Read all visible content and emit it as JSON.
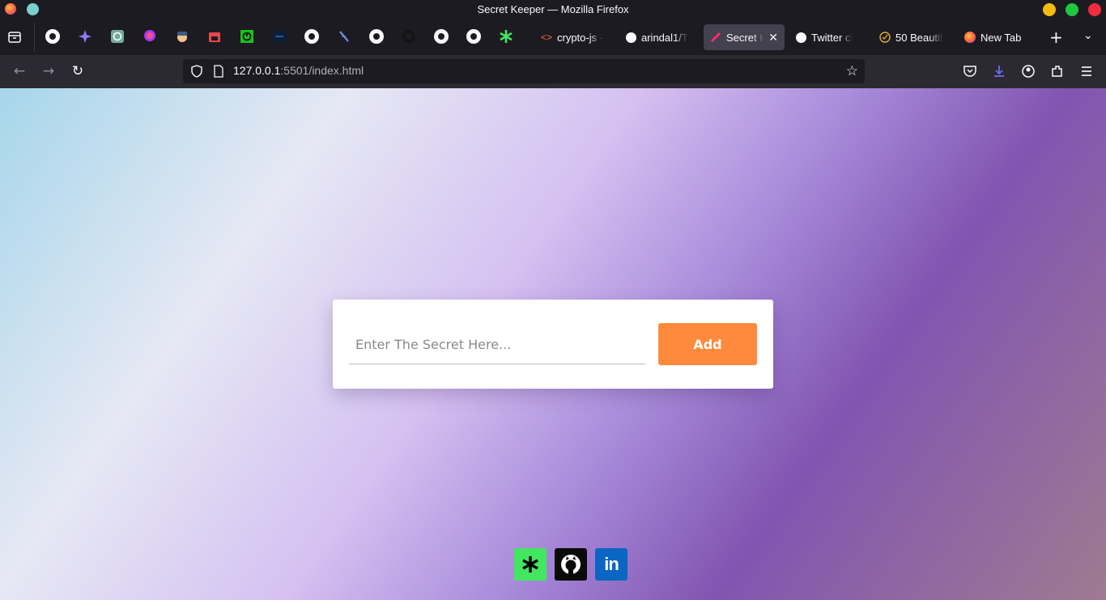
{
  "window": {
    "title": "Secret Keeper — Mozilla Firefox"
  },
  "tabs": [
    {
      "label": "crypto-js -",
      "icon": "code-icon"
    },
    {
      "label": "arindal1/T",
      "icon": "github-icon"
    },
    {
      "label": "Secret K",
      "icon": "pen-icon",
      "active": true
    },
    {
      "label": "Twitter cl",
      "icon": "github-icon"
    },
    {
      "label": "50 Beautif",
      "icon": "check-circle-icon"
    },
    {
      "label": "New Tab",
      "icon": "firefox-icon"
    }
  ],
  "pinned_tabs": [
    "github-icon",
    "sparkle-icon",
    "openai-icon",
    "messenger-icon",
    "avatar-icon",
    "store-icon",
    "power-icon",
    "terminal-icon",
    "github-icon",
    "tool-icon",
    "github-icon",
    "github-dark-icon",
    "github-icon",
    "github-icon",
    "linktree-icon"
  ],
  "address": {
    "host": "127.0.0.1",
    "path": ":5501/index.html"
  },
  "page": {
    "input_placeholder": "Enter The Secret Here...",
    "add_label": "Add",
    "social": [
      "linktree-icon",
      "github-icon",
      "linkedin-icon"
    ]
  },
  "colors": {
    "accent": "#ff8a3d",
    "linktree": "#43e660",
    "linkedin": "#0a66c2"
  }
}
